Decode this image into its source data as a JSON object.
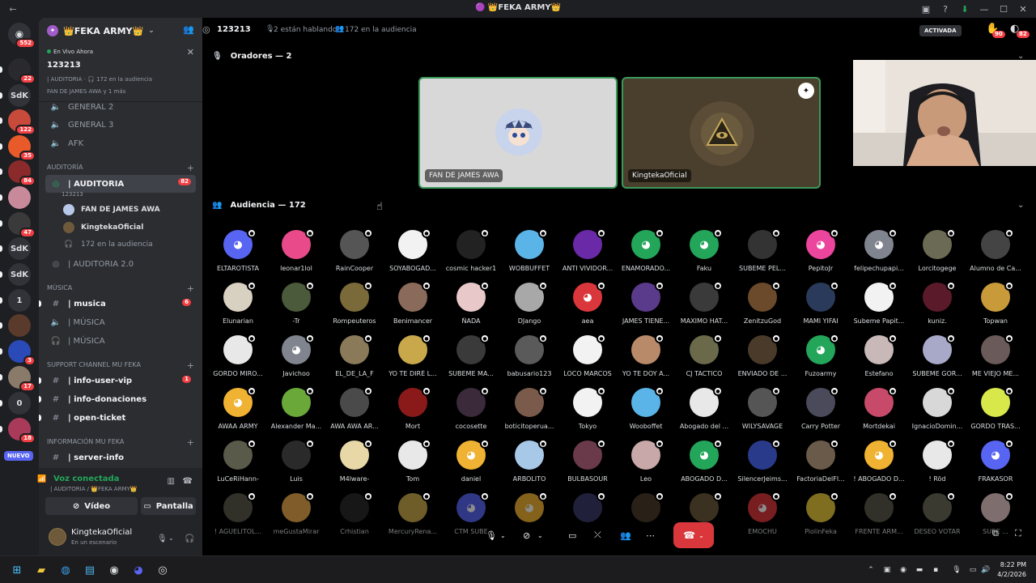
{
  "window": {
    "title": "🟣 👑FEKA ARMY👑"
  },
  "rail": {
    "home_badge": "552",
    "servers": [
      {
        "label": "",
        "badge": "22"
      },
      {
        "label": "SdK",
        "badge": ""
      },
      {
        "label": "",
        "badge": "122"
      },
      {
        "label": "",
        "badge": "35"
      },
      {
        "label": "",
        "badge": "84"
      },
      {
        "label": "",
        "badge": ""
      },
      {
        "label": "",
        "badge": "47"
      },
      {
        "label": "SdK",
        "badge": ""
      },
      {
        "label": "SdK",
        "badge": ""
      },
      {
        "label": "1",
        "badge": ""
      },
      {
        "label": "",
        "badge": ""
      },
      {
        "label": "",
        "badge": "3"
      },
      {
        "label": "",
        "badge": "17"
      },
      {
        "label": "0",
        "badge": ""
      },
      {
        "label": "",
        "badge": "18"
      }
    ],
    "new_label": "NUEVO"
  },
  "sidebar": {
    "server_name": "👑FEKA ARMY👑",
    "live": {
      "label": "En Vivo Ahora",
      "title": "123213",
      "meta": "| AUDITORIA · 🎧 172 en la audiencia",
      "people": "FAN DE JAMES AWA y 1 más"
    },
    "channels_top": [
      {
        "name": "GENERAL 2"
      },
      {
        "name": "GENERAL 3"
      },
      {
        "name": "AFK"
      }
    ],
    "cat_auditoria": "AUDITORÍA",
    "auditoria": {
      "name": "| AUDITORIA",
      "badge": "82",
      "topic": "123213"
    },
    "speakers": [
      "FAN DE JAMES AWA",
      "KingtekaOficial"
    ],
    "audience_count": "172 en la audiencia",
    "auditoria2": "| AUDITORIA 2.0",
    "cat_musica": "MÚSICA",
    "musica": [
      {
        "name": "| musica",
        "badge": "6"
      },
      {
        "name": "| MÚSICA",
        "badge": ""
      },
      {
        "name": "| MÚSICA",
        "badge": ""
      }
    ],
    "cat_support": "SUPPORT CHANNEL MU FEKA",
    "support": [
      {
        "name": "| info-user-vip",
        "badge": "1"
      },
      {
        "name": "| info-donaciones",
        "badge": ""
      },
      {
        "name": "| open-ticket",
        "badge": ""
      }
    ],
    "cat_info": "INFORMACIÓN MU FEKA",
    "info": [
      {
        "name": "| server-info"
      }
    ],
    "voice": {
      "status": "Voz conectada",
      "sub": "| AUDITORIA / 👑FEKA ARMY👑",
      "video": "Vídeo",
      "screen": "Pantalla"
    },
    "user": {
      "name": "KingtekaOficial",
      "status": "En un escenario"
    }
  },
  "main": {
    "channel": "123213",
    "talking": "2 están hablando",
    "audience": "172 en la audiencia",
    "activated": "ACTIVADA",
    "hand_badge": "90",
    "inbox_badge": "82",
    "speakers_header": "Oradores — 2",
    "audience_header": "Audiencia — 172",
    "speakers": [
      {
        "name": "FAN DE JAMES AWA"
      },
      {
        "name": "KingtekaOficial"
      }
    ]
  },
  "audience": [
    {
      "name": "ELTAROTISTA",
      "color": "#5865f2",
      "discord": true
    },
    {
      "name": "leonar1lol",
      "color": "#e84a8a"
    },
    {
      "name": "RainCooper",
      "color": "#555555"
    },
    {
      "name": "SOYABOGAD...",
      "color": "#f2f2f2"
    },
    {
      "name": "cosmic hacker1",
      "color": "#222222"
    },
    {
      "name": "WOBBUFFET",
      "color": "#5ab4e8"
    },
    {
      "name": "ANTI VIVIDOR...",
      "color": "#6a2aa8"
    },
    {
      "name": "ENAMORADO...",
      "color": "#23a55a",
      "discord": true
    },
    {
      "name": "Faku",
      "color": "#23a55a",
      "discord": true
    },
    {
      "name": "SUBEME PEL...",
      "color": "#333333"
    },
    {
      "name": "PepitoJr",
      "color": "#eb459e",
      "discord": true
    },
    {
      "name": "felipechupapi...",
      "color": "#80848e",
      "discord": true
    },
    {
      "name": "Lorcitogege",
      "color": "#6b6b55"
    },
    {
      "name": "Alumno de Ca...",
      "color": "#444444"
    },
    {
      "name": "Elunarian",
      "color": "#d8d0c0"
    },
    {
      "name": "-Tr",
      "color": "#4a5a3a"
    },
    {
      "name": "Rompeuteros",
      "color": "#7a6a3a"
    },
    {
      "name": "Benimancer",
      "color": "#8a6a5a"
    },
    {
      "name": "ÑADA",
      "color": "#e8c8c8"
    },
    {
      "name": "DJango",
      "color": "#a8a8a8"
    },
    {
      "name": "aea",
      "color": "#da373c",
      "discord": true
    },
    {
      "name": "JAMES TIENE...",
      "color": "#5a3a8a"
    },
    {
      "name": "MAXIMO HAT...",
      "color": "#3a3a3a"
    },
    {
      "name": "ZenitzuGod",
      "color": "#6a4a2a"
    },
    {
      "name": "MAMI YIFAI",
      "color": "#2a3a5a"
    },
    {
      "name": "Subeme Papit...",
      "color": "#f2f2f2"
    },
    {
      "name": "kuniz.",
      "color": "#5a1a2a"
    },
    {
      "name": "Topwan",
      "color": "#c89a3a"
    },
    {
      "name": "GORDO MIRO...",
      "color": "#e8e8e8"
    },
    {
      "name": "Javichoo",
      "color": "#80848e",
      "discord": true
    },
    {
      "name": "EL_DE_LA_F",
      "color": "#8a7a5a"
    },
    {
      "name": "YO TE DIRÉ L...",
      "color": "#c8a84a"
    },
    {
      "name": "SUBEME MA...",
      "color": "#3a3a3a"
    },
    {
      "name": "babusario123",
      "color": "#5a5a5a"
    },
    {
      "name": "LOCO MARCOS",
      "color": "#f2f2f2"
    },
    {
      "name": "YO TE DOY A...",
      "color": "#b88a6a"
    },
    {
      "name": "CJ TACTICO",
      "color": "#6a6a4a"
    },
    {
      "name": "ENVIADO DE ...",
      "color": "#4a3a2a"
    },
    {
      "name": "Fuzoarmy",
      "color": "#23a55a",
      "discord": true
    },
    {
      "name": "Estefano",
      "color": "#c8b8b8"
    },
    {
      "name": "SUBEME GOR...",
      "color": "#a8a8c8"
    },
    {
      "name": "ME VIEJO ME...",
      "color": "#6a5a5a"
    },
    {
      "name": "AWAA ARMY",
      "color": "#f0b232",
      "discord": true
    },
    {
      "name": "Alexander Ma...",
      "color": "#6aa83a"
    },
    {
      "name": "AWA AWA AR...",
      "color": "#4a4a4a"
    },
    {
      "name": "Mort",
      "color": "#8a1a1a"
    },
    {
      "name": "cocosette",
      "color": "#3a2a3a"
    },
    {
      "name": "boticitoperua...",
      "color": "#7a5a4a"
    },
    {
      "name": "Tokyo",
      "color": "#f2f2f2"
    },
    {
      "name": "Wooboffet",
      "color": "#5ab4e8"
    },
    {
      "name": "Abogado del ...",
      "color": "#e8e8e8"
    },
    {
      "name": "WILYSAVAGE",
      "color": "#555555"
    },
    {
      "name": "Carry Potter",
      "color": "#4a4a5a"
    },
    {
      "name": "Mortdekai",
      "color": "#c84a6a"
    },
    {
      "name": "IgnacioDomin...",
      "color": "#d8d8d8"
    },
    {
      "name": "GORDO TRAS...",
      "color": "#d8e84a"
    },
    {
      "name": "LuCeRiHann-",
      "color": "#5a5a4a"
    },
    {
      "name": "Luis",
      "color": "#2a2a2a"
    },
    {
      "name": "M4lware-",
      "color": "#e8d8a8"
    },
    {
      "name": "Tom",
      "color": "#e8e8e8"
    },
    {
      "name": "daniel",
      "color": "#f0b232",
      "discord": true
    },
    {
      "name": "ARBOLITO",
      "color": "#a8c8e8"
    },
    {
      "name": "BULBASOUR",
      "color": "#6a3a4a"
    },
    {
      "name": "Leo",
      "color": "#c8a8a8"
    },
    {
      "name": "ABOGADO D...",
      "color": "#23a55a",
      "discord": true
    },
    {
      "name": "SilencerJeims...",
      "color": "#2a3a8a"
    },
    {
      "name": "FactoriaDelFl...",
      "color": "#6a5a4a"
    },
    {
      "name": "! ABOGADO D...",
      "color": "#f0b232",
      "discord": true
    },
    {
      "name": "! Röd",
      "color": "#e8e8e8"
    },
    {
      "name": "FRAKASOR",
      "color": "#5865f2",
      "discord": true
    },
    {
      "name": "! AGUELITOL...",
      "color": "#5a5a4a"
    },
    {
      "name": "meGustaMirar",
      "color": "#e8a84a"
    },
    {
      "name": "Crhistian",
      "color": "#2a2a2a"
    },
    {
      "name": "MercuryRena...",
      "color": "#c8a84a"
    },
    {
      "name": "CTM SUBE",
      "color": "#5865f2",
      "discord": true
    },
    {
      "name": "",
      "color": "#f0b232",
      "discord": true
    },
    {
      "name": "",
      "color": "#3a3a6a"
    },
    {
      "name": "",
      "color": "#4a3a2a"
    },
    {
      "name": "PEG...",
      "color": "#6a5a3a"
    },
    {
      "name": "EMOCHU",
      "color": "#da373c",
      "discord": true
    },
    {
      "name": "PiolinFeka",
      "color": "#e8c83a"
    },
    {
      "name": "FRENTE ARM...",
      "color": "#5a5a4a"
    },
    {
      "name": "DESEO VOTAR",
      "color": "#6a6a5a"
    },
    {
      "name": "SUBE ...",
      "color": "#e8c8c8"
    }
  ],
  "taskbar": {
    "time": "8:22 PM",
    "date": "4/2/2026"
  }
}
